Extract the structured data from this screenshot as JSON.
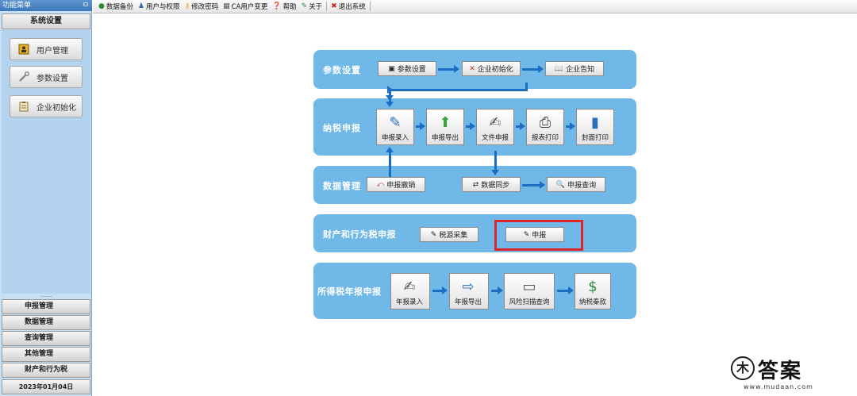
{
  "sidebar": {
    "title": "功能菜单",
    "pin": "ㅁ",
    "header": "系统设置",
    "buttons": [
      {
        "label": "用户管理",
        "icon": "user-card-icon"
      },
      {
        "label": "参数设置",
        "icon": "wrench-icon"
      },
      {
        "label": "企业初始化",
        "icon": "clipboard-icon"
      }
    ],
    "grip": "........",
    "menus": [
      "申报管理",
      "数据管理",
      "查询管理",
      "其他管理",
      "财产和行为税"
    ],
    "date": "2023年01月04日"
  },
  "toolbar": {
    "items": [
      {
        "label": "数据备份",
        "icon": "backup-icon"
      },
      {
        "label": "用户与权限",
        "icon": "user-icon"
      },
      {
        "label": "修改密码",
        "icon": "key-icon"
      },
      {
        "label": "CA用户变更",
        "icon": "ca-icon"
      },
      {
        "label": "帮助",
        "icon": "help-icon"
      },
      {
        "label": "关于",
        "icon": "tag-icon"
      },
      {
        "label": "退出系统",
        "icon": "exit-icon"
      }
    ]
  },
  "panels": {
    "params": {
      "title": "参数设置",
      "buttons": [
        "参数设置",
        "企业初始化",
        "企业告知"
      ]
    },
    "declare": {
      "title": "纳税申报",
      "tiles": [
        "申报录入",
        "申报导出",
        "文件申报",
        "报表打印",
        "封面打印"
      ]
    },
    "data": {
      "title": "数据管理",
      "buttons": [
        "申报撤销",
        "数据同步",
        "申报查询"
      ]
    },
    "property": {
      "title": "财产和行为税申报",
      "buttons": [
        "税源采集",
        "申报"
      ]
    },
    "income": {
      "title": "所得税年报申报",
      "tiles": [
        "年报录入",
        "年报导出",
        "风险扫描查询",
        "纳税秦款"
      ]
    }
  },
  "watermark": {
    "logo": "木",
    "name": "答案",
    "url": "www.mudaan.com"
  },
  "colors": {
    "panel": "#6fb8e8",
    "arrow": "#1a6fc3",
    "highlight": "#e0262d"
  }
}
